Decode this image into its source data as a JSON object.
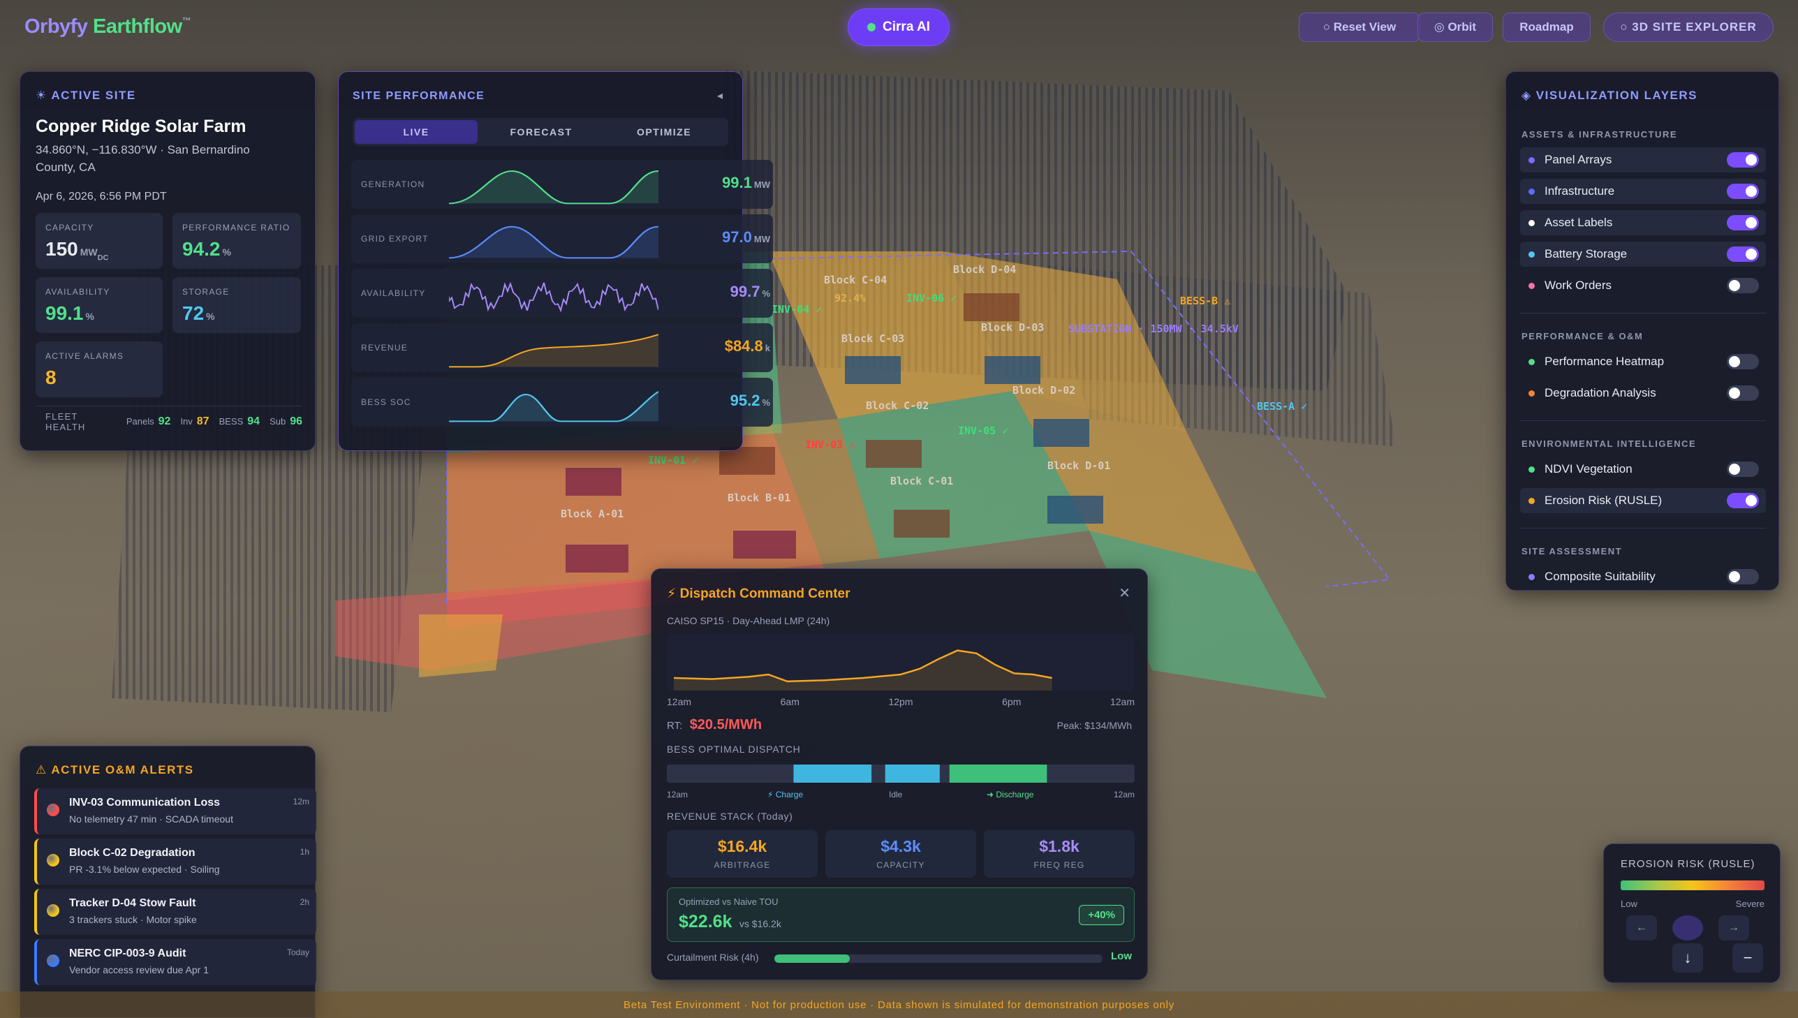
{
  "brand": {
    "name1": "Orbyfy",
    "name2": "Earthflow",
    "tm": "™"
  },
  "center_button": "Cirra AI",
  "top_buttons": [
    {
      "label": "○ Reset View"
    },
    {
      "label": "◎ Orbit"
    },
    {
      "label": "Roadmap"
    },
    {
      "label": "○ 3D SITE EXPLORER"
    }
  ],
  "active_site": {
    "heading": "☀ ACTIVE SITE",
    "name": "Copper Ridge Solar Farm",
    "location1": "34.860°N, −116.830°W · San Bernardino",
    "location2": "County, CA",
    "datetime": "Apr 6, 2026, 6:56 PM PDT",
    "stats": [
      {
        "label": "CAPACITY",
        "value": "150",
        "unit": "MW",
        "sub": "DC",
        "color": "#e8eaf4"
      },
      {
        "label": "PERFORMANCE RATIO",
        "value": "94.2",
        "unit": "%",
        "color": "#52e08a"
      },
      {
        "label": "AVAILABILITY",
        "value": "99.1",
        "unit": "%",
        "color": "#52e08a"
      },
      {
        "label": "STORAGE",
        "value": "72",
        "unit": "%",
        "color": "#52c7f0"
      },
      {
        "label": "ACTIVE ALARMS",
        "value": "8",
        "unit": "",
        "color": "#f5b82e"
      }
    ],
    "fleet": {
      "label": "FLEET HEALTH",
      "panels_label": "Panels",
      "panels": "92",
      "inv_label": "Inv",
      "inv": "87",
      "bess_label": "BESS",
      "bess": "94",
      "sub_label": "Sub",
      "sub": "96"
    }
  },
  "site_performance": {
    "heading": "SITE PERFORMANCE",
    "collapse": "◂",
    "tabs": [
      "LIVE",
      "FORECAST",
      "OPTIMIZE"
    ],
    "rows": [
      {
        "label": "GENERATION",
        "value": "99.1",
        "unit": "MW",
        "color": "#52e08a"
      },
      {
        "label": "GRID EXPORT",
        "value": "97.0",
        "unit": "MW",
        "color": "#5b8dff"
      },
      {
        "label": "AVAILABILITY",
        "value": "99.7",
        "unit": "%",
        "color": "#a78bfa"
      },
      {
        "label": "REVENUE",
        "value": "$84.8",
        "unit": "k",
        "color": "#f5a623"
      },
      {
        "label": "BESS SOC",
        "value": "95.2",
        "unit": "%",
        "color": "#52c7f0"
      }
    ]
  },
  "layers": {
    "heading": "◈ VISUALIZATION LAYERS",
    "sections": [
      {
        "title": "ASSETS & INFRASTRUCTURE",
        "items": [
          {
            "name": "Panel Arrays",
            "color": "#7c6cff",
            "on": true
          },
          {
            "name": "Infrastructure",
            "color": "#5b6cff",
            "on": true
          },
          {
            "name": "Asset Labels",
            "color": "#ffffff",
            "on": true
          },
          {
            "name": "Battery Storage",
            "color": "#52c7f0",
            "on": true
          },
          {
            "name": "Work Orders",
            "color": "#ff6fa8",
            "on": false
          }
        ]
      },
      {
        "title": "PERFORMANCE & O&M",
        "items": [
          {
            "name": "Performance Heatmap",
            "color": "#52e08a",
            "on": false
          },
          {
            "name": "Degradation Analysis",
            "color": "#f5823a",
            "on": false
          }
        ]
      },
      {
        "title": "ENVIRONMENTAL INTELLIGENCE",
        "items": [
          {
            "name": "NDVI Vegetation",
            "color": "#52e08a",
            "on": false
          },
          {
            "name": "Erosion Risk (RUSLE)",
            "color": "#f5a623",
            "on": true
          }
        ]
      },
      {
        "title": "SITE ASSESSMENT",
        "items": [
          {
            "name": "Composite Suitability",
            "color": "#8f7cff",
            "on": false
          }
        ]
      }
    ]
  },
  "alerts": {
    "heading": "⚠ ACTIVE O&M ALERTS",
    "items": [
      {
        "title": "INV-03 Communication Loss",
        "sub": "No telemetry 47 min · SCADA timeout",
        "time": "12m",
        "color": "#ff4d4d"
      },
      {
        "title": "Block C-02 Degradation",
        "sub": "PR -3.1% below expected · Soiling",
        "time": "1h",
        "color": "#f5c518"
      },
      {
        "title": "Tracker D-04 Stow Fault",
        "sub": "3 trackers stuck · Motor spike",
        "time": "2h",
        "color": "#f5c518"
      },
      {
        "title": "NERC CIP-003-9 Audit",
        "sub": "Vendor access review due Apr 1",
        "time": "Today",
        "color": "#3b7cff"
      }
    ]
  },
  "dispatch": {
    "heading": "⚡ Dispatch Command Center",
    "close": "✕",
    "subtitle": "CAISO SP15 · Day-Ahead LMP (24h)",
    "xticks": [
      "12am",
      "6am",
      "12pm",
      "6pm",
      "12am"
    ],
    "rt_label": "RT:",
    "rt_value": "$20.5/MWh",
    "peak": "Peak: $134/MWh",
    "bess_heading": "BESS OPTIMAL DISPATCH",
    "bess_ticks": {
      "start": "12am",
      "charge": "⚡ Charge",
      "idle": "Idle",
      "discharge": "➜ Discharge",
      "end": "12am"
    },
    "revenue_heading": "REVENUE STACK (Today)",
    "revenue": [
      {
        "value": "$16.4k",
        "label": "ARBITRAGE",
        "color": "#f5a623"
      },
      {
        "value": "$4.3k",
        "label": "CAPACITY",
        "color": "#5b8dff"
      },
      {
        "value": "$1.8k",
        "label": "FREQ REG",
        "color": "#a78bfa"
      }
    ],
    "opt_label": "Optimized vs Naive TOU",
    "opt_value": "$22.6k",
    "opt_vs": "vs $16.2k",
    "opt_badge": "+40%",
    "curt_label": "Curtailment Risk (4h)",
    "curt_value": "Low"
  },
  "erosion_legend": {
    "title": "EROSION RISK (RUSLE)",
    "low": "Low",
    "high": "Severe"
  },
  "nav": {
    "down": "↓",
    "minus": "−"
  },
  "footer": "Beta Test Environment · Not for production use · Data shown is simulated for demonstration purposes only",
  "map_labels": [
    {
      "text": "Block C-04",
      "color": "#d8ccc0"
    },
    {
      "text": "92.4%",
      "color": "#e0b050"
    },
    {
      "text": "Block D-04",
      "color": "#d8ccc0"
    },
    {
      "text": "Block C-03",
      "color": "#d8ccc0"
    },
    {
      "text": "Block D-03",
      "color": "#d8ccc0"
    },
    {
      "text": "Block C-02",
      "color": "#d8ccc0"
    },
    {
      "text": "Block D-02",
      "color": "#d8ccc0"
    },
    {
      "text": "Block C-01",
      "color": "#d8ccc0"
    },
    {
      "text": "Block D-01",
      "color": "#d8ccc0"
    },
    {
      "text": "Block B-01",
      "color": "#d8ccc0"
    },
    {
      "text": "Block A-01",
      "color": "#d8ccc0"
    },
    {
      "text": "INV-04 ✓",
      "color": "#3be07a"
    },
    {
      "text": "INV-06 ✓",
      "color": "#3be07a"
    },
    {
      "text": "INV-05 ✓",
      "color": "#3be07a"
    },
    {
      "text": "INV-01 ✓",
      "color": "#3be07a"
    },
    {
      "text": "INV-03 ⚠",
      "color": "#ff4040"
    },
    {
      "text": "SUBSTATION · 150MW · 34.5kV",
      "color": "#9a7cff"
    },
    {
      "text": "BESS-B ⚠",
      "color": "#f5a623"
    },
    {
      "text": "BESS-A ✓",
      "color": "#52c7f0"
    }
  ],
  "lmp_curve": [
    [
      0,
      0.78
    ],
    [
      2,
      0.8
    ],
    [
      4,
      0.76
    ],
    [
      5,
      0.72
    ],
    [
      6,
      0.84
    ],
    [
      8,
      0.82
    ],
    [
      10,
      0.78
    ],
    [
      12,
      0.72
    ],
    [
      13,
      0.62
    ],
    [
      14,
      0.45
    ],
    [
      15,
      0.3
    ],
    [
      16,
      0.35
    ],
    [
      17,
      0.55
    ],
    [
      18,
      0.7
    ],
    [
      19,
      0.72
    ],
    [
      20,
      0.78
    ]
  ],
  "bess_blocks": [
    {
      "start": 6.5,
      "end": 10.5,
      "kind": "charge"
    },
    {
      "start": 11.2,
      "end": 14,
      "kind": "charge"
    },
    {
      "start": 14.5,
      "end": 19.5,
      "kind": "discharge"
    }
  ],
  "curtailment_fill": 0.23
}
